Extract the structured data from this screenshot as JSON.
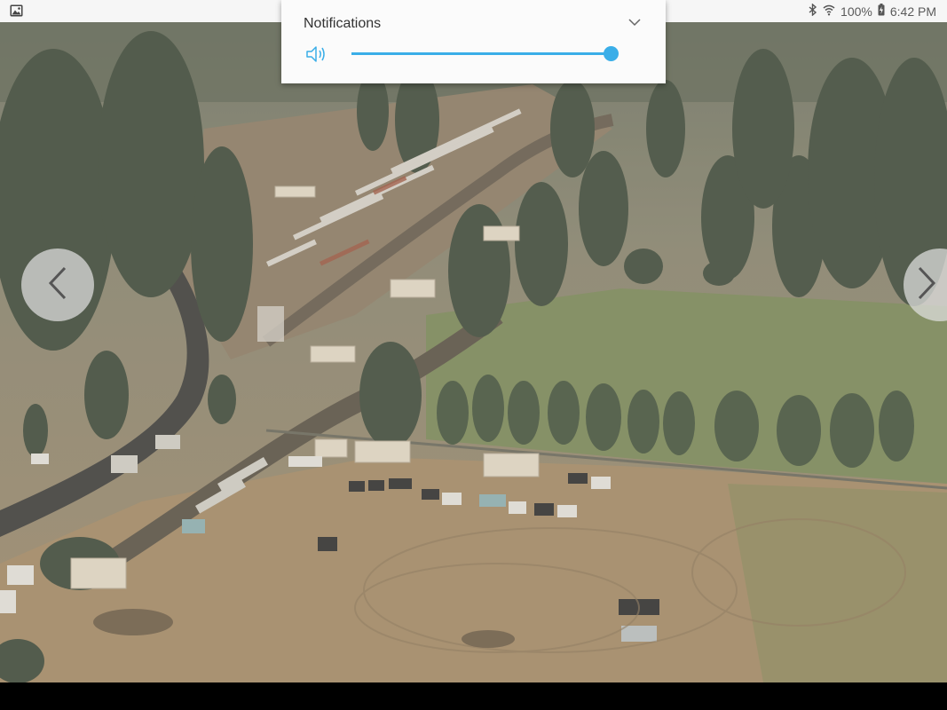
{
  "status_bar": {
    "left_icon": "gallery-icon",
    "bluetooth_icon": "bluetooth-icon",
    "wifi_icon": "wifi-icon",
    "battery_percent": "100%",
    "battery_icon": "battery-charging-icon",
    "time": "6:42 PM"
  },
  "volume_panel": {
    "title": "Notifications",
    "expand_icon": "chevron-down-icon",
    "speaker_icon": "speaker-icon",
    "level": 1.0,
    "accent_color": "#3aaee8"
  },
  "viewer": {
    "prev_icon": "chevron-left-icon",
    "next_icon": "chevron-right-icon"
  }
}
